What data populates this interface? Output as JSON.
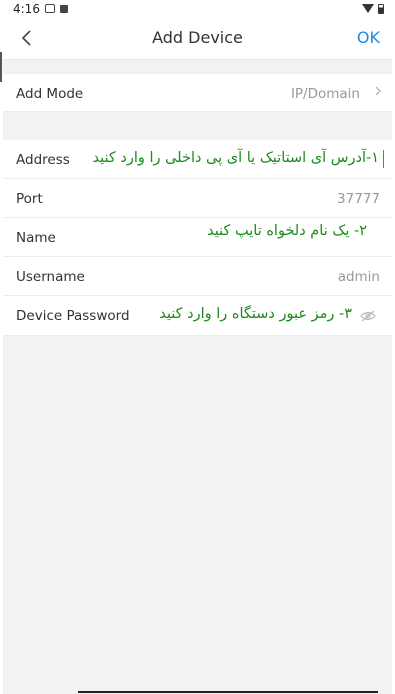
{
  "status_bar": {
    "time": "4:16",
    "icons": [
      "gallery-icon",
      "notification-icon"
    ],
    "right_icons": [
      "wifi-icon",
      "battery-icon"
    ]
  },
  "navbar": {
    "back_icon": "chevron-left-icon",
    "title": "Add Device",
    "ok_label": "OK"
  },
  "add_mode": {
    "label": "Add Mode",
    "value": "IP/Domain",
    "icon": "chevron-right-icon"
  },
  "form": {
    "address": {
      "label": "Address",
      "annotation": "۱-آدرس آی استاتیک یا آی پی  داخلی را وارد کنید"
    },
    "port": {
      "label": "Port",
      "placeholder": "37777"
    },
    "name": {
      "label": "Name",
      "annotation": "۲- یک نام دلخواه تایپ کنید"
    },
    "username": {
      "label": "Username",
      "placeholder": "admin"
    },
    "password": {
      "label": "Device Password",
      "annotation": "۳- رمز عبور دستگاه را وارد کنید",
      "icon": "eye-off-icon"
    }
  },
  "colors": {
    "accent": "#1e88e5",
    "annotation": "#1d8a1d",
    "background": "#f2f2f2"
  }
}
